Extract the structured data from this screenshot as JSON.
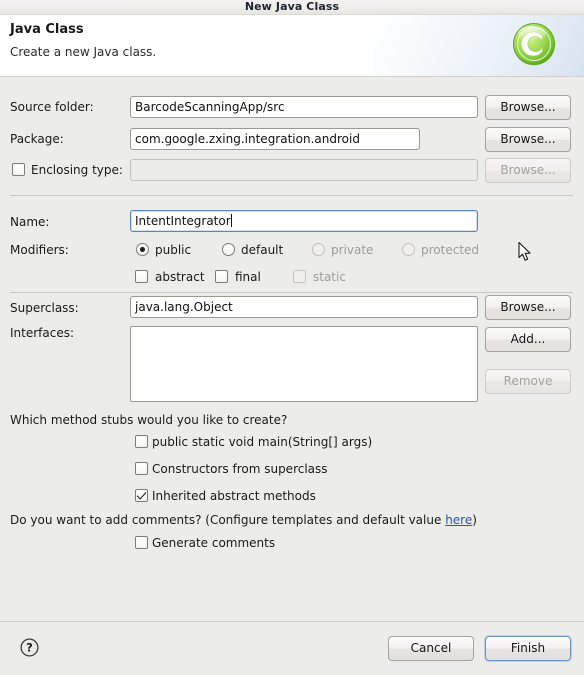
{
  "window": {
    "title": "New Java Class"
  },
  "header": {
    "title": "Java Class",
    "subtitle": "Create a new Java class.",
    "icon": "java-class-icon"
  },
  "form": {
    "source_folder": {
      "label": "Source folder:",
      "value": "BarcodeScanningApp/src",
      "browse_label": "Browse..."
    },
    "package": {
      "label": "Package:",
      "value": "com.google.zxing.integration.android",
      "browse_label": "Browse..."
    },
    "enclosing_type": {
      "label": "Enclosing type:",
      "value": "",
      "checked": false,
      "browse_label": "Browse...",
      "enabled": false
    },
    "name": {
      "label": "Name:",
      "value": "IntentIntegrator",
      "focused": true
    },
    "modifiers": {
      "label": "Modifiers:",
      "access": [
        {
          "label": "public",
          "selected": true,
          "enabled": true
        },
        {
          "label": "default",
          "selected": false,
          "enabled": true
        },
        {
          "label": "private",
          "selected": false,
          "enabled": false
        },
        {
          "label": "protected",
          "selected": false,
          "enabled": false
        }
      ],
      "flags": [
        {
          "label": "abstract",
          "checked": false,
          "enabled": true
        },
        {
          "label": "final",
          "checked": false,
          "enabled": true
        },
        {
          "label": "static",
          "checked": false,
          "enabled": false
        }
      ]
    },
    "superclass": {
      "label": "Superclass:",
      "value": "java.lang.Object",
      "browse_label": "Browse..."
    },
    "interfaces": {
      "label": "Interfaces:",
      "items": [],
      "add_label": "Add...",
      "remove_label": "Remove",
      "remove_enabled": false
    },
    "method_stubs": {
      "question": "Which method stubs would you like to create?",
      "options": [
        {
          "label": "public static void main(String[] args)",
          "checked": false
        },
        {
          "label": "Constructors from superclass",
          "checked": false
        },
        {
          "label": "Inherited abstract methods",
          "checked": true
        }
      ]
    },
    "comments": {
      "question_prefix": "Do you want to add comments? (Configure templates and default value ",
      "link_label": "here",
      "question_suffix": ")",
      "option": {
        "label": "Generate comments",
        "checked": false
      }
    }
  },
  "footer": {
    "help_label": "?",
    "cancel_label": "Cancel",
    "finish_label": "Finish"
  },
  "colors": {
    "accent_green": "#7ac943",
    "link_blue": "#2a58a6",
    "focus_blue": "#5f86bd",
    "dialog_bg": "#ececeb",
    "header_bg": "#ffffff"
  }
}
